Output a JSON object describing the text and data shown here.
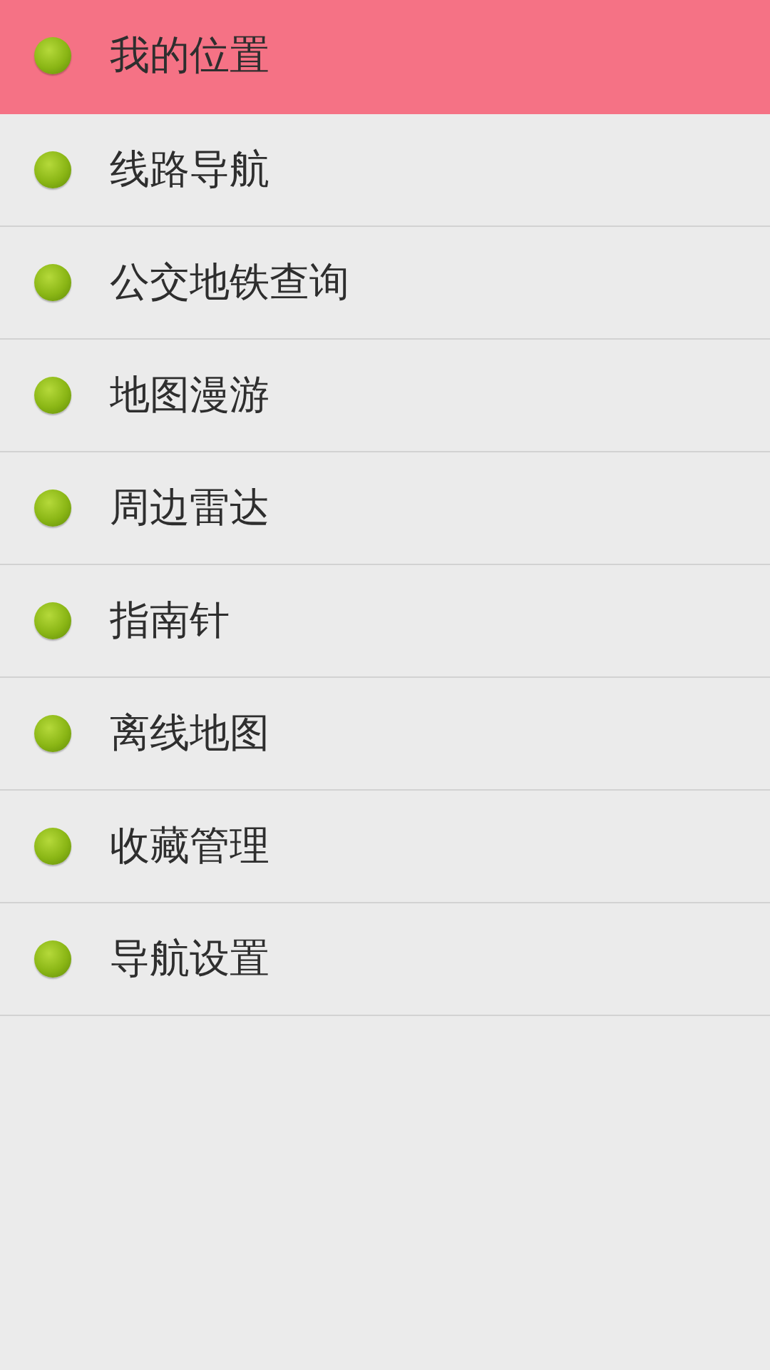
{
  "menu": [
    {
      "label": "我的位置",
      "selected": true
    },
    {
      "label": "线路导航",
      "selected": false
    },
    {
      "label": "公交地铁查询",
      "selected": false
    },
    {
      "label": "地图漫游",
      "selected": false
    },
    {
      "label": "周边雷达",
      "selected": false
    },
    {
      "label": "指南针",
      "selected": false
    },
    {
      "label": "离线地图",
      "selected": false
    },
    {
      "label": "收藏管理",
      "selected": false
    },
    {
      "label": "导航设置",
      "selected": false
    }
  ]
}
